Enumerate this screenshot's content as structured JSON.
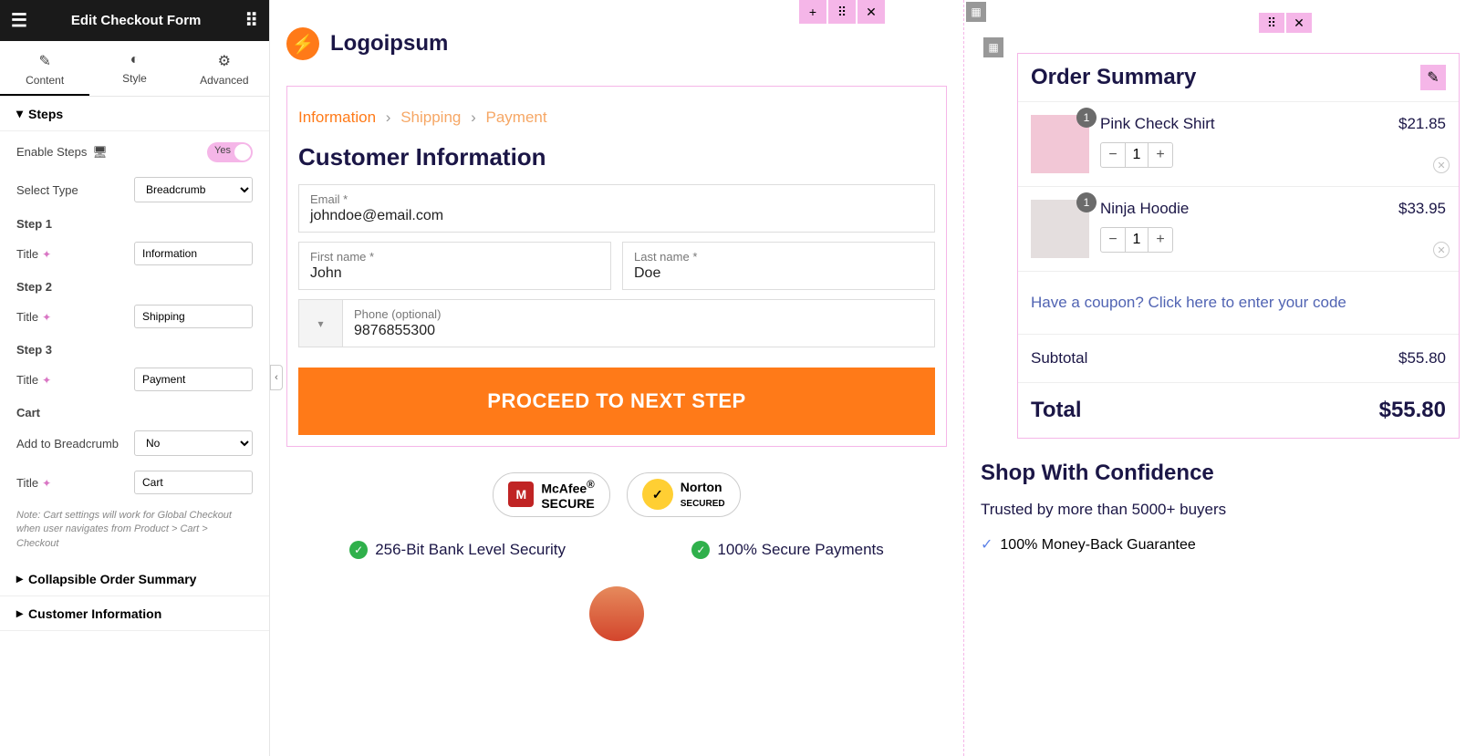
{
  "sidebar": {
    "title": "Edit Checkout Form",
    "tabs": {
      "content": "Content",
      "style": "Style",
      "advanced": "Advanced"
    },
    "steps_section": "Steps",
    "enable_steps_label": "Enable Steps",
    "enable_steps_value": "Yes",
    "select_type_label": "Select Type",
    "select_type_value": "Breadcrumb",
    "step1_label": "Step 1",
    "step2_label": "Step 2",
    "step3_label": "Step 3",
    "title_label": "Title",
    "step1_value": "Information",
    "step2_value": "Shipping",
    "step3_value": "Payment",
    "cart_label": "Cart",
    "add_breadcrumb_label": "Add to Breadcrumb",
    "add_breadcrumb_value": "No",
    "cart_title_value": "Cart",
    "note": "Note: Cart settings will work for Global Checkout when user navigates from Product > Cart > Checkout",
    "accordion1": "Collapsible Order Summary",
    "accordion2": "Customer Information"
  },
  "preview": {
    "logo_text": "Logoipsum",
    "crumbs": {
      "c1": "Information",
      "c2": "Shipping",
      "c3": "Payment"
    },
    "section_title": "Customer Information",
    "email_label": "Email *",
    "email_value": "johndoe@email.com",
    "first_label": "First name *",
    "first_value": "John",
    "last_label": "Last name *",
    "last_value": "Doe",
    "phone_label": "Phone (optional)",
    "phone_value": "9876855300",
    "proceed": "PROCEED TO NEXT STEP",
    "badge1a": "McAfee",
    "badge1b": "SECURE",
    "badge2a": "Norton",
    "badge2b": "SECURED",
    "trust1": "256-Bit Bank Level Security",
    "trust2": "100% Secure Payments"
  },
  "summary": {
    "title": "Order Summary",
    "items": [
      {
        "name": "Pink Check Shirt",
        "price": "$21.85",
        "qty": "1"
      },
      {
        "name": "Ninja Hoodie",
        "price": "$33.95",
        "qty": "1"
      }
    ],
    "coupon": "Have a coupon? Click here to enter your code",
    "subtotal_label": "Subtotal",
    "subtotal_value": "$55.80",
    "total_label": "Total",
    "total_value": "$55.80"
  },
  "confidence": {
    "title": "Shop With Confidence",
    "subtitle": "Trusted by more than 5000+ buyers",
    "point1": "100% Money-Back Guarantee"
  }
}
